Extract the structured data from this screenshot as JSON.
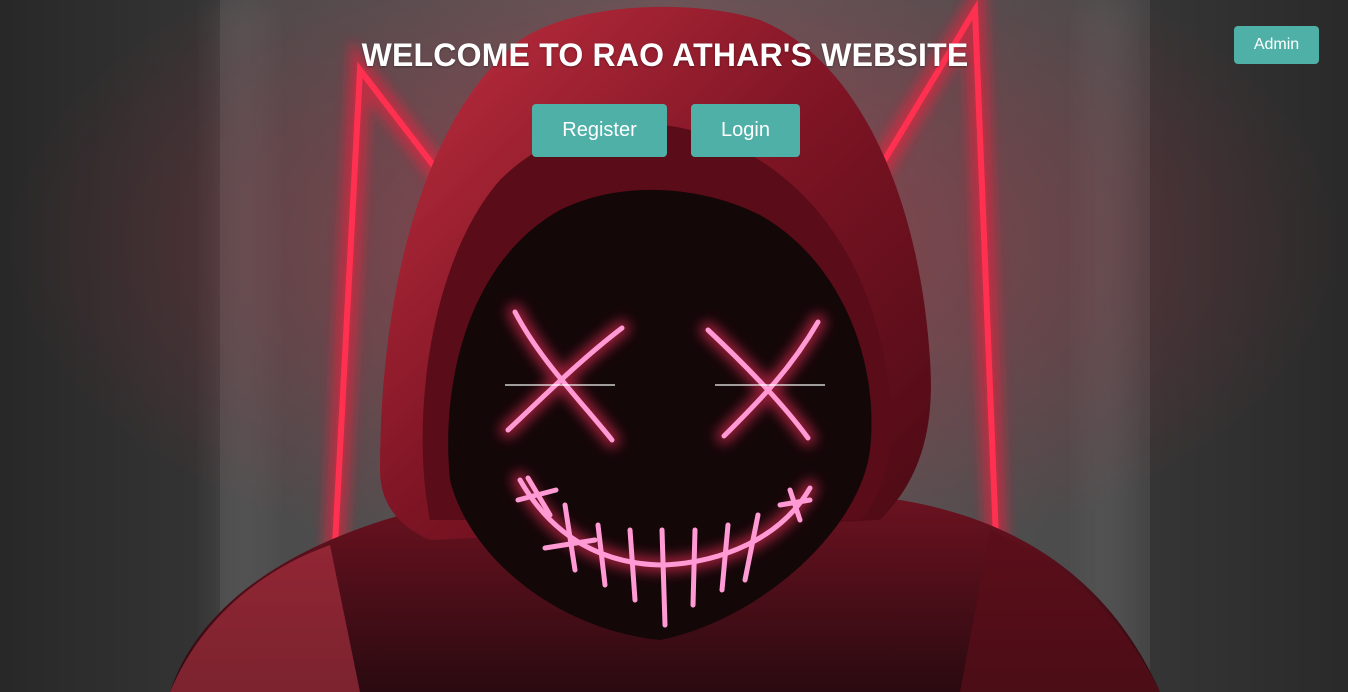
{
  "header": {
    "title": "WELCOME TO RAO ATHAR'S WEBSITE"
  },
  "actions": {
    "register_label": "Register",
    "login_label": "Login",
    "admin_label": "Admin"
  },
  "colors": {
    "button_bg": "#4fb0a8",
    "button_text": "#ffffff",
    "title_text": "#ffffff",
    "neon_red": "#ff1a3c",
    "neon_pink": "#ff9ad5",
    "hood": "#7a1020"
  },
  "background": {
    "image_subject": "hooded-figure-neon-mask"
  }
}
